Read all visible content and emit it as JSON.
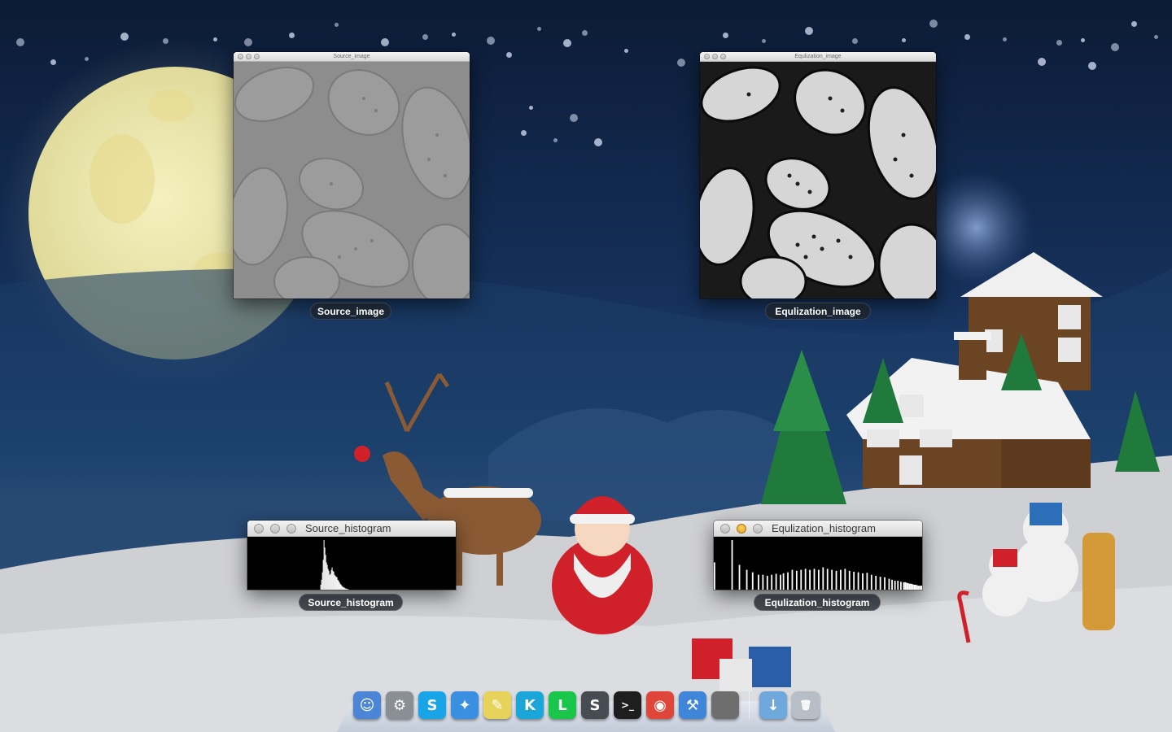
{
  "windows": {
    "source_image": {
      "title": "Source_image",
      "caption": "Source_image"
    },
    "equalization_image": {
      "title": "Equlization_image",
      "caption": "Equlization_image"
    },
    "source_histogram": {
      "title": "Source_histogram",
      "caption": "Source_histogram"
    },
    "equalization_histogram": {
      "title": "Equlization_histogram",
      "caption": "Equlization_histogram"
    }
  },
  "dock": {
    "items": [
      {
        "name": "finder-icon",
        "glyph": "☺",
        "color": "#4b86d6"
      },
      {
        "name": "system-preferences-icon",
        "glyph": "⚙",
        "color": "#8a8f96"
      },
      {
        "name": "skype-icon",
        "glyph": "S",
        "color": "#17a5e8"
      },
      {
        "name": "safari-icon",
        "glyph": "✦",
        "color": "#3b8fe0"
      },
      {
        "name": "stickies-icon",
        "glyph": "✎",
        "color": "#e8d35a"
      },
      {
        "name": "kik-icon",
        "glyph": "K",
        "color": "#1aa6d9"
      },
      {
        "name": "line-icon",
        "glyph": "L",
        "color": "#18c64a"
      },
      {
        "name": "sublime-text-icon",
        "glyph": "S",
        "color": "#474b52"
      },
      {
        "name": "terminal-icon",
        "glyph": ">_",
        "color": "#1e1e1e"
      },
      {
        "name": "chrome-icon",
        "glyph": "◉",
        "color": "#e0453a"
      },
      {
        "name": "xcode-icon",
        "glyph": "⚒",
        "color": "#3f86d8"
      },
      {
        "name": "minimized-window-icon",
        "glyph": "",
        "color": "#6e6e6e"
      }
    ],
    "right_items": [
      {
        "name": "downloads-folder-icon",
        "glyph": "↓",
        "color": "#6fa8dc"
      },
      {
        "name": "trash-icon",
        "glyph": "🗑",
        "color": "#b8bec6"
      }
    ]
  },
  "colors": {
    "sky_top": "#0c1b36",
    "moon": "#e9e6a8",
    "snow": "#d9dadc",
    "histogram_bg": "#000000",
    "histogram_bar": "#ffffff"
  },
  "source_histogram_data": [
    0,
    0,
    0,
    0,
    0,
    0,
    0,
    0,
    0,
    0,
    0,
    0,
    0,
    0,
    0,
    0,
    0,
    0,
    0,
    0,
    0,
    0,
    0,
    0,
    0,
    0,
    0,
    0,
    0,
    0,
    0,
    0,
    0,
    0,
    0,
    0,
    0,
    0,
    0,
    0,
    0,
    0,
    0,
    0,
    0,
    0,
    0,
    0,
    0,
    0,
    0,
    0,
    0,
    0,
    0,
    0,
    0,
    0,
    0,
    0,
    0,
    0,
    0,
    0,
    0,
    0,
    0,
    0,
    0,
    0,
    0,
    0,
    0,
    0,
    0,
    0,
    0,
    0,
    0,
    0,
    0,
    0,
    0,
    0,
    0,
    0,
    0,
    0,
    0,
    0,
    0.1,
    0.2,
    0.35,
    0.6,
    1.0,
    0.85,
    0.7,
    0.55,
    0.5,
    0.42,
    0.38,
    0.3,
    0.32,
    0.4,
    0.45,
    0.38,
    0.36,
    0.3,
    0.28,
    0.26,
    0.25,
    0.2,
    0.18,
    0.15,
    0.12,
    0.1,
    0.08,
    0.06,
    0.05,
    0.04,
    0.03,
    0.02,
    0.02,
    0.01,
    0.01,
    0,
    0,
    0,
    0,
    0,
    0,
    0,
    0,
    0,
    0,
    0,
    0,
    0,
    0,
    0,
    0,
    0,
    0,
    0,
    0,
    0,
    0,
    0,
    0,
    0,
    0,
    0,
    0,
    0,
    0,
    0,
    0,
    0,
    0,
    0,
    0,
    0,
    0,
    0,
    0,
    0,
    0,
    0,
    0,
    0,
    0,
    0,
    0,
    0,
    0,
    0,
    0,
    0,
    0,
    0,
    0,
    0,
    0,
    0,
    0,
    0,
    0,
    0,
    0,
    0,
    0,
    0,
    0,
    0,
    0,
    0,
    0,
    0,
    0,
    0,
    0,
    0,
    0,
    0,
    0,
    0,
    0,
    0,
    0,
    0,
    0,
    0,
    0,
    0,
    0,
    0,
    0,
    0,
    0,
    0,
    0,
    0,
    0,
    0,
    0,
    0,
    0,
    0,
    0,
    0,
    0,
    0,
    0,
    0,
    0,
    0,
    0,
    0,
    0,
    0,
    0,
    0,
    0,
    0,
    0,
    0,
    0,
    0,
    0,
    0,
    0,
    0,
    0,
    0,
    0,
    0,
    0
  ],
  "equalization_histogram_data": [
    0.55,
    0,
    0,
    0,
    0,
    0,
    0,
    0,
    0,
    0,
    0,
    0,
    1.0,
    0,
    0,
    0,
    0,
    0.5,
    0,
    0,
    0,
    0,
    0.4,
    0,
    0,
    0,
    0.35,
    0,
    0,
    0,
    0.3,
    0,
    0,
    0.3,
    0,
    0,
    0.28,
    0,
    0,
    0.3,
    0,
    0,
    0.32,
    0,
    0,
    0.3,
    0,
    0.33,
    0,
    0,
    0.35,
    0,
    0,
    0.4,
    0,
    0,
    0.38,
    0,
    0,
    0.4,
    0,
    0,
    0.42,
    0,
    0,
    0.4,
    0,
    0,
    0.42,
    0,
    0,
    0.4,
    0,
    0,
    0.45,
    0,
    0,
    0.42,
    0,
    0,
    0.4,
    0,
    0,
    0.38,
    0,
    0,
    0.4,
    0,
    0,
    0.42,
    0,
    0,
    0.38,
    0,
    0,
    0.36,
    0,
    0,
    0.35,
    0,
    0,
    0.33,
    0,
    0,
    0.34,
    0,
    0,
    0.3,
    0,
    0,
    0.28,
    0,
    0,
    0.26,
    0,
    0,
    0.25,
    0,
    0,
    0.22,
    0,
    0.2,
    0,
    0.18,
    0,
    0.18,
    0,
    0.16,
    0,
    0.15,
    0.15,
    0.14,
    0.13,
    0.12,
    0.12,
    0.11,
    0.1,
    0.1,
    0.09,
    0.08,
    0.08,
    0.08
  ]
}
